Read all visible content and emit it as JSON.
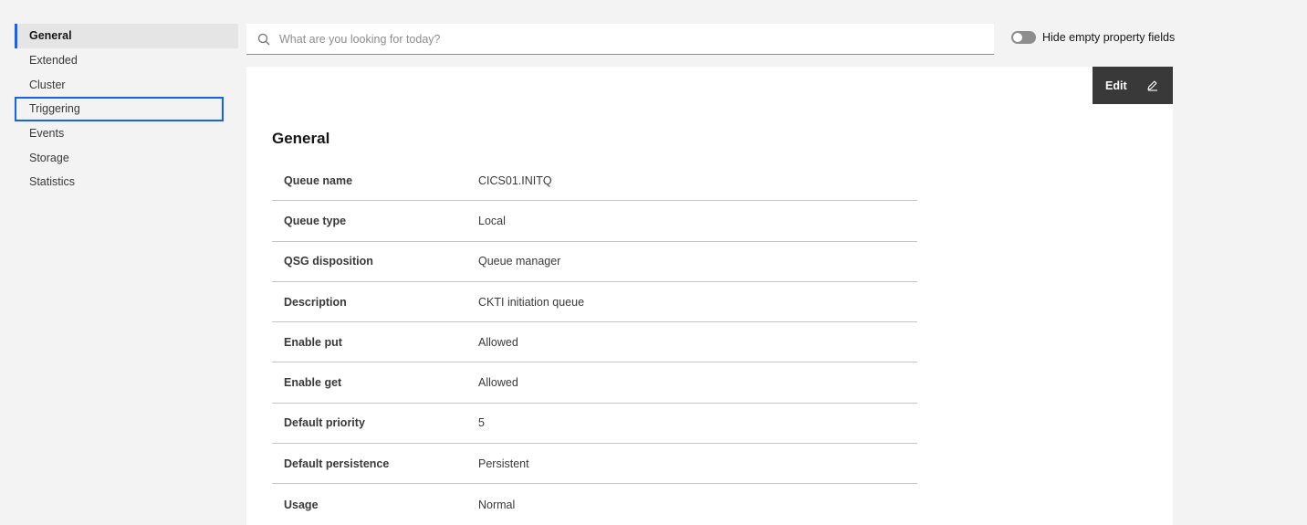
{
  "sidebar": {
    "items": [
      {
        "label": "General"
      },
      {
        "label": "Extended"
      },
      {
        "label": "Cluster"
      },
      {
        "label": "Triggering"
      },
      {
        "label": "Events"
      },
      {
        "label": "Storage"
      },
      {
        "label": "Statistics"
      }
    ]
  },
  "search": {
    "placeholder": "What are you looking for today?",
    "value": "",
    "icon": "search-icon"
  },
  "toggle": {
    "label": "Hide empty property fields",
    "state": "off"
  },
  "toolbar": {
    "edit_label": "Edit",
    "edit_icon": "pencil-icon"
  },
  "section": {
    "title": "General"
  },
  "properties": [
    {
      "key": "Queue name",
      "value": "CICS01.INITQ"
    },
    {
      "key": "Queue type",
      "value": "Local"
    },
    {
      "key": "QSG disposition",
      "value": "Queue manager"
    },
    {
      "key": "Description",
      "value": "CKTI initiation queue"
    },
    {
      "key": "Enable put",
      "value": "Allowed"
    },
    {
      "key": "Enable get",
      "value": "Allowed"
    },
    {
      "key": "Default priority",
      "value": "5"
    },
    {
      "key": "Default persistence",
      "value": "Persistent"
    },
    {
      "key": "Usage",
      "value": "Normal"
    }
  ],
  "colors": {
    "accent": "#0f62fe",
    "background": "#f3f3f3",
    "panel": "#ffffff",
    "button": "#393939"
  }
}
